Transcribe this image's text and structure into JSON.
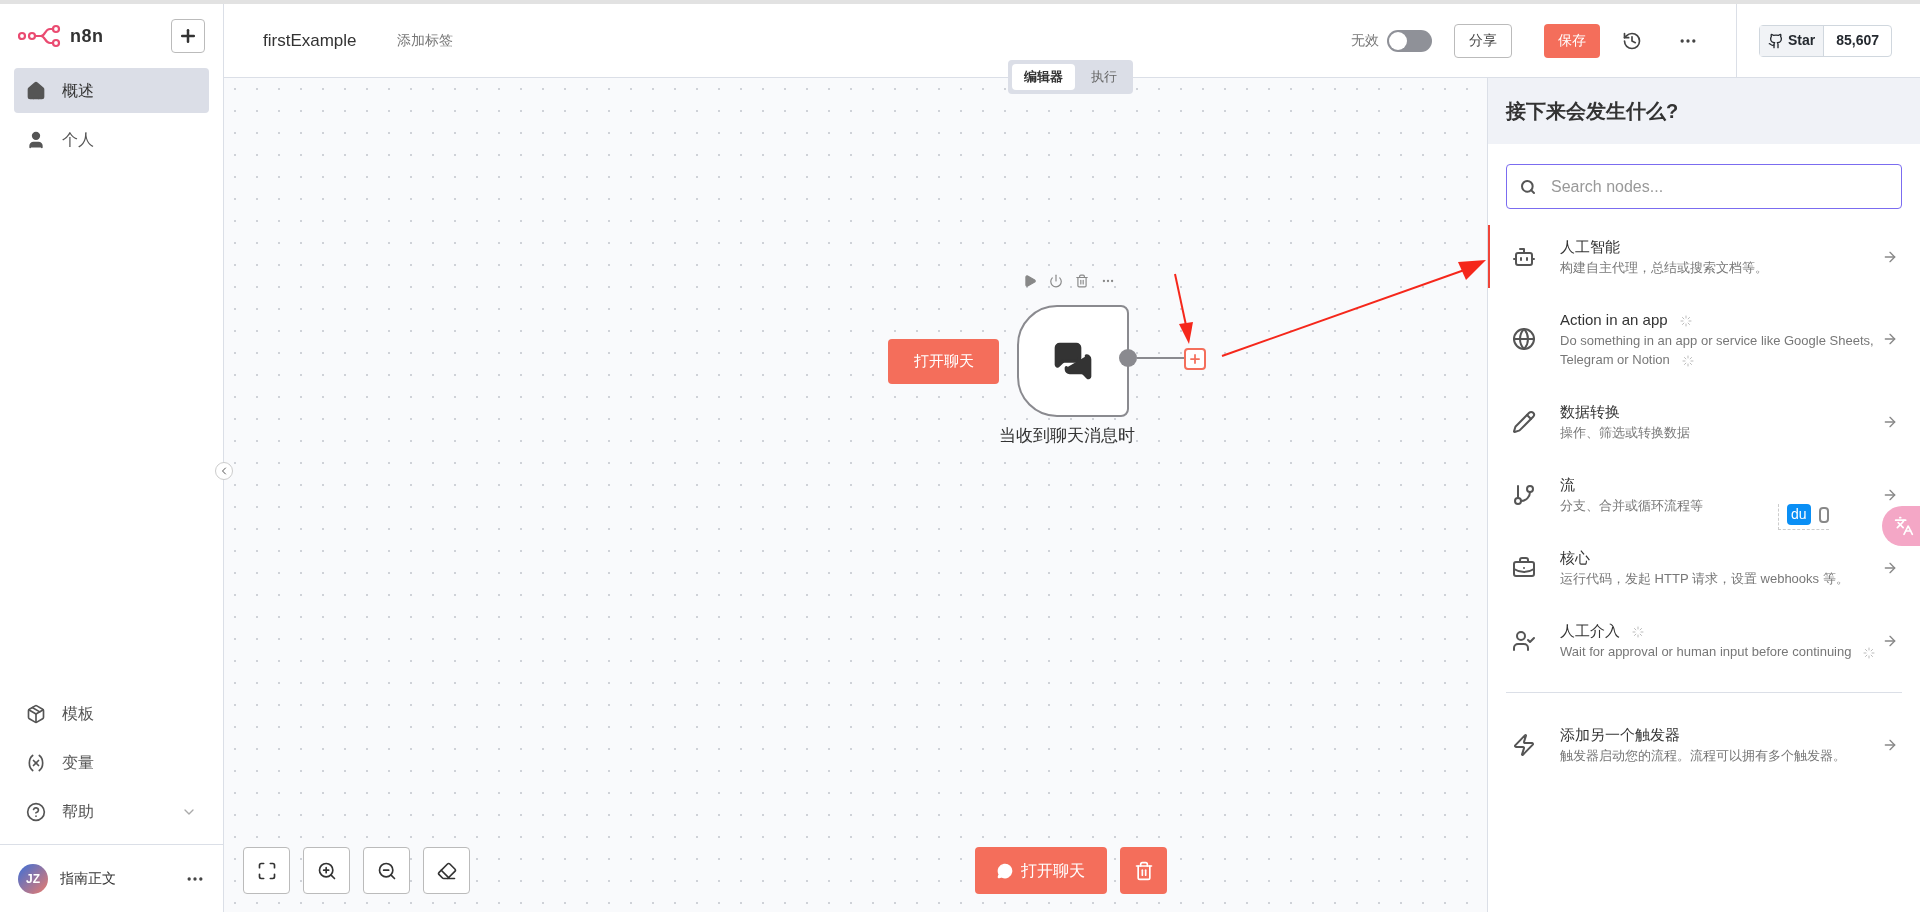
{
  "sidebar": {
    "logo": "n8n",
    "items": [
      {
        "label": "概述",
        "selected": true
      },
      {
        "label": "个人",
        "selected": false
      }
    ],
    "bottom_items": [
      {
        "label": "模板",
        "expandable": false
      },
      {
        "label": "变量",
        "expandable": false
      },
      {
        "label": "帮助",
        "expandable": true
      }
    ],
    "user": {
      "initials": "JZ",
      "name": "指南正文"
    }
  },
  "header": {
    "workflow_name": "firstExample",
    "add_tag": "添加标签",
    "active_label": "无效",
    "active": false,
    "share": "分享",
    "save": "保存",
    "github": {
      "star": "Star",
      "count": "85,607"
    }
  },
  "canvas_tabs": [
    {
      "label": "编辑器",
      "selected": true
    },
    {
      "label": "执行",
      "selected": false
    }
  ],
  "canvas": {
    "open_chat_node": "打开聊天",
    "trigger_node": {
      "label": "当收到聊天消息时"
    },
    "footer_button": "打开聊天"
  },
  "panel": {
    "title": "接下来会发生什么?",
    "search": {
      "placeholder": "Search nodes..."
    },
    "items": [
      {
        "title": "人工智能",
        "subtitle": "构建自主代理，总结或搜索文档等。",
        "loading": false,
        "highlighted": true
      },
      {
        "title": "Action in an app",
        "subtitle": "Do something in an app or service like Google Sheets, Telegram or Notion",
        "loading": true,
        "highlighted": false
      },
      {
        "title": "数据转换",
        "subtitle": "操作、筛选或转换数据",
        "loading": false,
        "highlighted": false
      },
      {
        "title": "流",
        "subtitle": "分支、合并或循环流程等",
        "loading": false,
        "highlighted": false
      },
      {
        "title": "核心",
        "subtitle": "运行代码，发起 HTTP 请求，设置 webhooks 等。",
        "loading": false,
        "highlighted": false
      },
      {
        "title": "人工介入",
        "subtitle": "Wait for approval or human input before continuing",
        "loading": true,
        "highlighted": false
      }
    ],
    "trigger_item": {
      "title": "添加另一个触发器",
      "subtitle": "触发器启动您的流程。流程可以拥有多个触发器。"
    }
  },
  "overlay": {
    "badge": "du"
  }
}
